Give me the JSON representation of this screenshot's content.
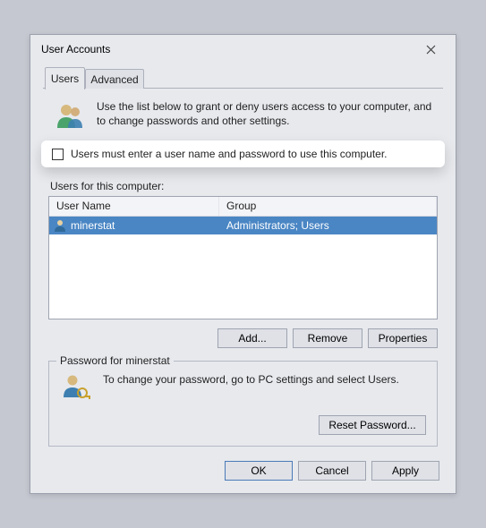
{
  "window": {
    "title": "User Accounts"
  },
  "tabs": {
    "users": "Users",
    "advanced": "Advanced"
  },
  "intro": "Use the list below to grant or deny users access to your computer, and to change passwords and other settings.",
  "checkbox_label": "Users must enter a user name and password to use this computer.",
  "users_section_label": "Users for this computer:",
  "columns": {
    "user": "User Name",
    "group": "Group"
  },
  "rows": [
    {
      "user": "minerstat",
      "group": "Administrators; Users"
    }
  ],
  "buttons": {
    "add": "Add...",
    "remove": "Remove",
    "properties": "Properties"
  },
  "password_box": {
    "legend": "Password for minerstat",
    "text": "To change your password, go to PC settings and select Users.",
    "reset": "Reset Password..."
  },
  "dialog_buttons": {
    "ok": "OK",
    "cancel": "Cancel",
    "apply": "Apply"
  }
}
